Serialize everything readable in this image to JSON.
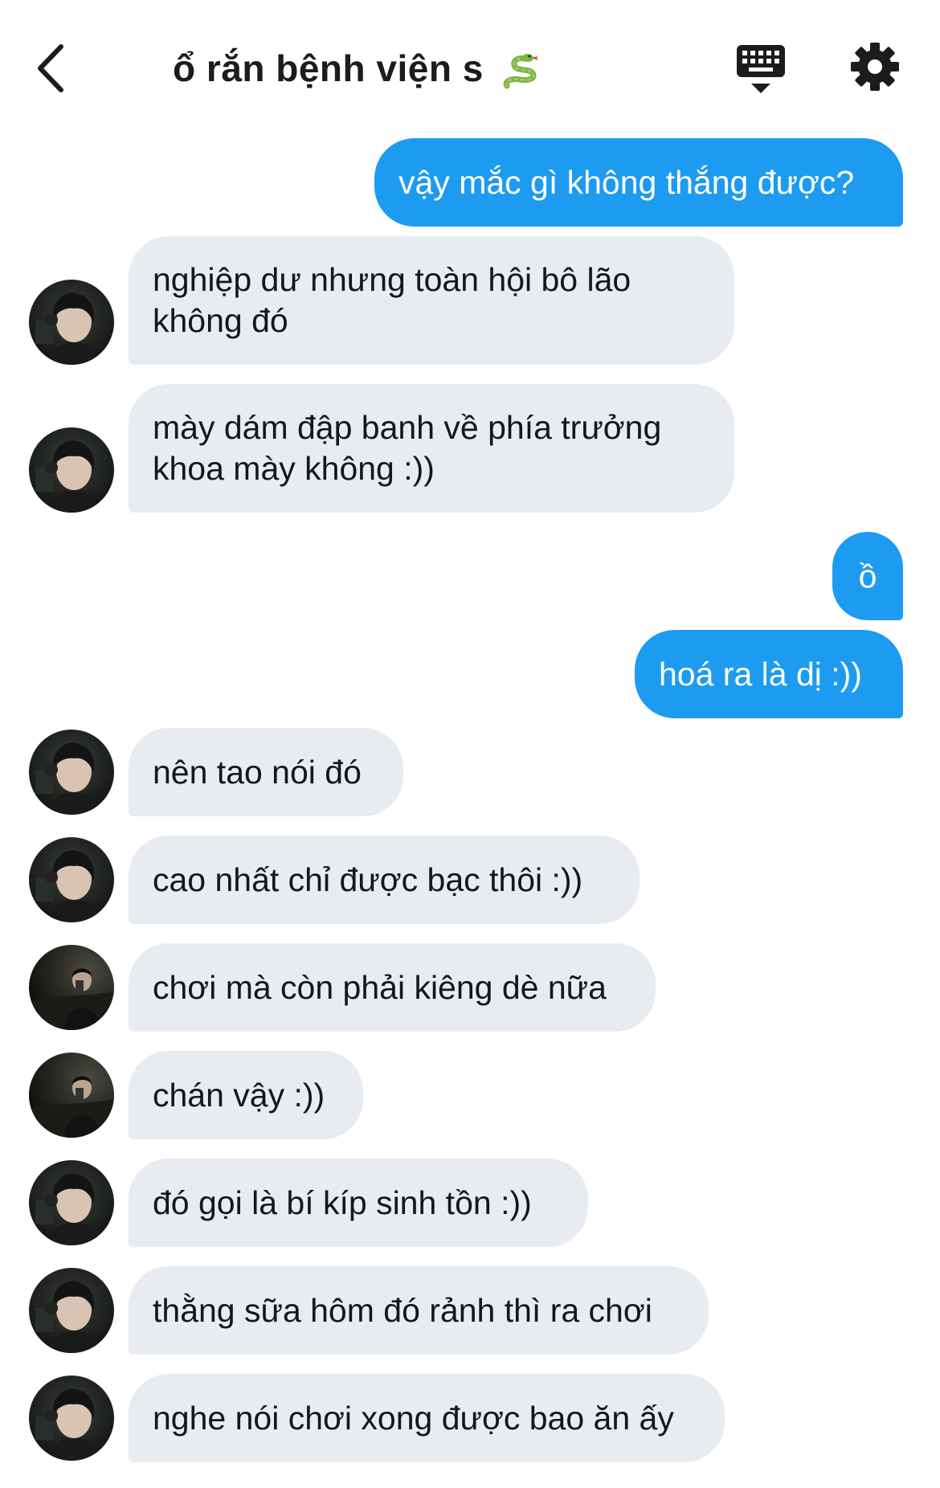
{
  "header": {
    "title": "ổ rắn bệnh viện s",
    "title_emoji": "snake-emoji",
    "back_icon": "chevron-left-icon",
    "keyboard_icon": "keyboard-hide-icon",
    "settings_icon": "gear-icon"
  },
  "colors": {
    "outgoing_bubble": "#1d9bf0",
    "incoming_bubble": "#e8ebef",
    "outgoing_text": "#ffffff",
    "incoming_text": "#14171a"
  },
  "messages": [
    {
      "direction": "out",
      "text": "vậy mắc gì không thắng được?"
    },
    {
      "direction": "in",
      "avatar": "avatar-a",
      "text": "nghiệp dư nhưng toàn hội bô lão không đó"
    },
    {
      "direction": "in",
      "avatar": "avatar-a",
      "text": "mày dám đập banh về phía trưởng khoa mày không :))"
    },
    {
      "direction": "out",
      "text": "ồ"
    },
    {
      "direction": "out",
      "text": "hoá ra là dị :))"
    },
    {
      "direction": "in",
      "avatar": "avatar-a",
      "text": "nên tao nói đó"
    },
    {
      "direction": "in",
      "avatar": "avatar-a",
      "text": "cao nhất chỉ được bạc thôi :))"
    },
    {
      "direction": "in",
      "avatar": "avatar-b",
      "text": "chơi mà còn phải kiêng dè nữa"
    },
    {
      "direction": "in",
      "avatar": "avatar-b",
      "text": "chán vậy :))"
    },
    {
      "direction": "in",
      "avatar": "avatar-a",
      "text": "đó gọi là bí kíp sinh tồn :))"
    },
    {
      "direction": "in",
      "avatar": "avatar-a",
      "text": "thằng sữa hôm đó rảnh thì ra chơi"
    },
    {
      "direction": "in",
      "avatar": "avatar-a",
      "text": "nghe nói chơi xong được bao ăn ấy"
    }
  ]
}
